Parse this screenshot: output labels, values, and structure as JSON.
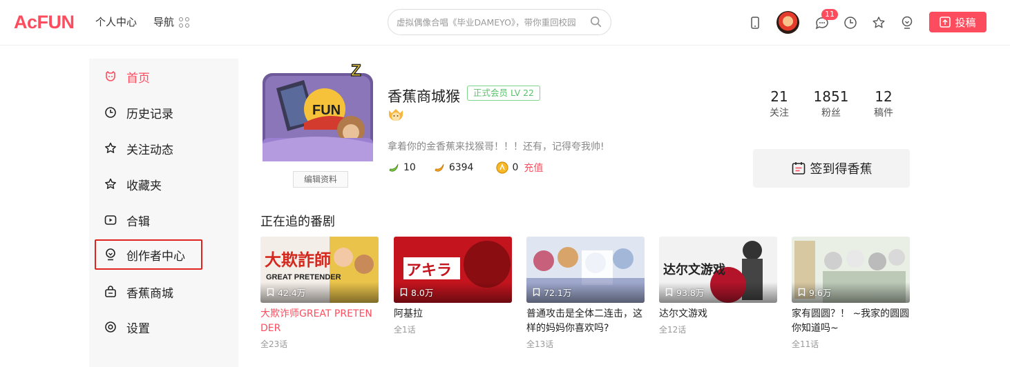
{
  "header": {
    "logo": "AcFUN",
    "nav_personal": "个人中心",
    "nav_guide": "导航",
    "search_placeholder": "虚拟偶像合唱《毕业DAMEYO》，带你重回校园",
    "message_count": "11",
    "upload_label": "投稿",
    "accent_color": "#fd4c5d"
  },
  "sidebar": {
    "items": [
      {
        "label": "首页",
        "icon": "home-icon"
      },
      {
        "label": "历史记录",
        "icon": "history-icon"
      },
      {
        "label": "关注动态",
        "icon": "follow-icon"
      },
      {
        "label": "收藏夹",
        "icon": "favorites-icon"
      },
      {
        "label": "合辑",
        "icon": "collection-icon"
      },
      {
        "label": "创作者中心",
        "icon": "creator-icon"
      },
      {
        "label": "香蕉商城",
        "icon": "shop-icon"
      },
      {
        "label": "设置",
        "icon": "settings-icon"
      }
    ],
    "active_index": 0,
    "highlighted_index": 5
  },
  "profile": {
    "username": "香蕉商城猴",
    "level": "正式会员 LV 22",
    "bio": "拿着你的金香蕉来找猴哥！！！还有，记得夸我帅!",
    "banana": "10",
    "gold_banana": "6394",
    "acoin": "0",
    "recharge": "充值",
    "edit_label": "编辑资料",
    "following": "21",
    "following_label": "关注",
    "fans": "1851",
    "fans_label": "粉丝",
    "posts": "12",
    "posts_label": "稿件",
    "signin_label": "签到得香蕉"
  },
  "bangumi": {
    "section_title": "正在追的番剧",
    "items": [
      {
        "title": "大欺诈师GREAT PRETENDER",
        "views": "42.4万",
        "episodes": "全23话",
        "highlight": true
      },
      {
        "title": "阿基拉",
        "views": "8.0万",
        "episodes": "全1话",
        "highlight": false
      },
      {
        "title": "普通攻击是全体二连击，这样的妈妈你喜欢吗?",
        "views": "72.1万",
        "episodes": "全13话",
        "highlight": false
      },
      {
        "title": "达尔文游戏",
        "views": "93.8万",
        "episodes": "全12话",
        "highlight": false
      },
      {
        "title": "家有圆圆？！ ~我家的圆圆你知道吗~",
        "views": "9.6万",
        "episodes": "全11话",
        "highlight": false
      }
    ]
  }
}
